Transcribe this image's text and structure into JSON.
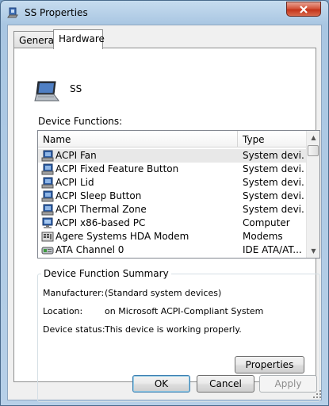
{
  "window": {
    "title": "SS Properties"
  },
  "tabs": [
    {
      "label": "General",
      "active": false
    },
    {
      "label": "Hardware",
      "active": true
    }
  ],
  "device": {
    "name": "SS",
    "icon": "laptop-icon"
  },
  "device_functions": {
    "label": "Device Functions:",
    "columns": [
      "Name",
      "Type"
    ],
    "rows": [
      {
        "name": "ACPI Fan",
        "type": "System devi...",
        "icon": "system-device-icon",
        "selected": true
      },
      {
        "name": "ACPI Fixed Feature Button",
        "type": "System devi...",
        "icon": "system-device-icon"
      },
      {
        "name": "ACPI Lid",
        "type": "System devi...",
        "icon": "system-device-icon"
      },
      {
        "name": "ACPI Sleep Button",
        "type": "System devi...",
        "icon": "system-device-icon"
      },
      {
        "name": "ACPI Thermal Zone",
        "type": "System devi...",
        "icon": "system-device-icon"
      },
      {
        "name": "ACPI x86-based PC",
        "type": "Computer",
        "icon": "computer-icon"
      },
      {
        "name": "Agere Systems HDA Modem",
        "type": "Modems",
        "icon": "modem-icon"
      },
      {
        "name": "ATA Channel 0",
        "type": "IDE ATA/AT...",
        "icon": "ide-channel-icon"
      }
    ]
  },
  "summary": {
    "title": "Device Function Summary",
    "manufacturer_label": "Manufacturer:",
    "manufacturer_value": "(Standard system devices)",
    "location_label": "Location:",
    "location_value": "on Microsoft ACPI-Compliant System",
    "status_label": "Device status:",
    "status_value": "This device is working properly.",
    "properties_button": "Properties"
  },
  "footer": {
    "ok": "OK",
    "cancel": "Cancel",
    "apply": "Apply"
  }
}
